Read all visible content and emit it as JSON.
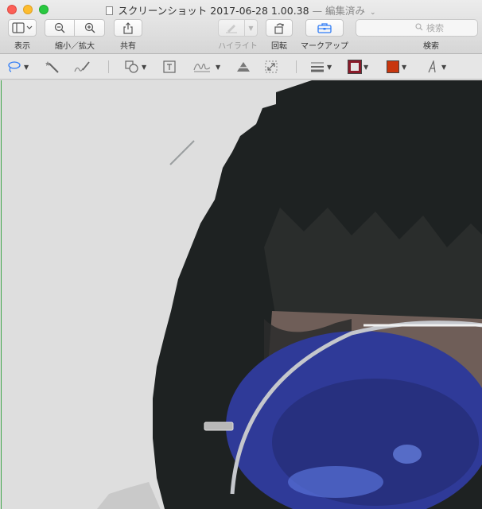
{
  "window": {
    "title": "スクリーンショット 2017-06-28 1.00.38",
    "title_suffix": "— 編集済み",
    "title_chevron": "⌄"
  },
  "toolbar": {
    "view_label": "表示",
    "zoom_label": "縮小／拡大",
    "share_label": "共有",
    "highlight_label": "ハイライト",
    "rotate_label": "回転",
    "markup_label": "マークアップ",
    "search_label": "検索",
    "search_placeholder": "検索"
  },
  "markup_tools": [
    {
      "name": "lasso-selection-icon"
    },
    {
      "name": "instant-alpha-icon"
    },
    {
      "name": "sketch-icon"
    },
    {
      "name": "shapes-icon"
    },
    {
      "name": "text-icon"
    },
    {
      "name": "sign-icon"
    },
    {
      "name": "adjust-color-icon"
    },
    {
      "name": "adjust-size-icon"
    },
    {
      "name": "shape-style-icon"
    },
    {
      "name": "border-color-icon"
    },
    {
      "name": "fill-color-icon"
    },
    {
      "name": "text-style-icon"
    }
  ],
  "colors": {
    "accent": "#2f7cf6",
    "border_color_swatch": "#8a1b2a",
    "fill_color_swatch": "#c8360e",
    "close": "#fc5f57",
    "minimize": "#fdbc2e",
    "maximize": "#28c840"
  }
}
